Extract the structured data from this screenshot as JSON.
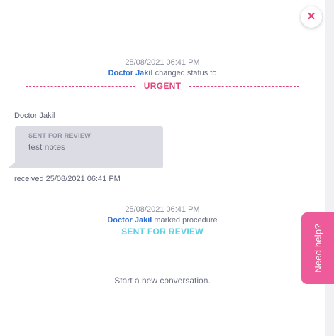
{
  "close": {
    "icon": "×"
  },
  "events": [
    {
      "timestamp": "25/08/2021 06:41 PM",
      "actor": "Doctor Jakil",
      "action": "changed status to",
      "status": "URGENT"
    },
    {
      "timestamp": "25/08/2021 06:41 PM",
      "actor": "Doctor Jakil",
      "action": "marked procedure",
      "status": "SENT FOR REVIEW"
    }
  ],
  "message": {
    "sender": "Doctor Jakil",
    "tag": "SENT FOR REVIEW",
    "text": "test notes",
    "received": "received 25/08/2021 06:41 PM"
  },
  "empty_state": "Start a new conversation.",
  "help_tab": {
    "label": "Need help?"
  },
  "colors": {
    "urgent": "#e0457b",
    "review": "#5cd0e2",
    "actor": "#2f6fcf",
    "help": "#ee5b9a"
  }
}
